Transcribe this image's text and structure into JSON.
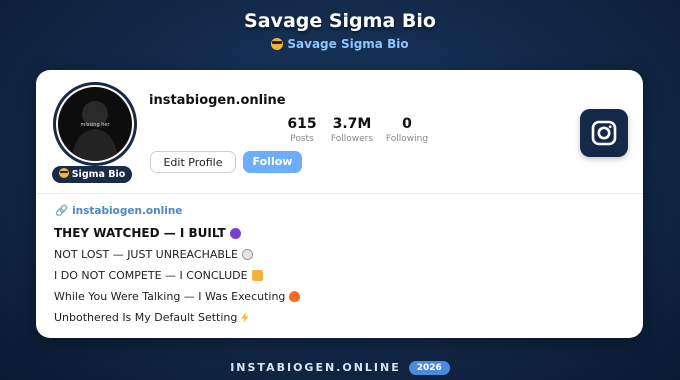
{
  "header": {
    "title": "Savage Sigma Bio",
    "subtitle": "Savage Sigma Bio",
    "subtitle_icon": "sunglasses-emoji-icon"
  },
  "profile": {
    "avatar_caption": "missing her",
    "badge_label": "Sigma Bio",
    "badge_icon": "sunglasses-emoji-icon",
    "username": "instabiogen.online",
    "stats": [
      {
        "value": "615",
        "label": "Posts"
      },
      {
        "value": "3.7M",
        "label": "Followers"
      },
      {
        "value": "0",
        "label": "Following"
      }
    ],
    "edit_button": "Edit Profile",
    "follow_button": "Follow",
    "instagram_icon": "instagram-icon"
  },
  "bio": {
    "link_icon": "link-icon",
    "link": "instabiogen.online",
    "lines": [
      {
        "text": "THEY WATCHED — I BUILT",
        "icon": "devil-emoji-icon"
      },
      {
        "text": "NOT LOST — JUST UNREACHABLE",
        "icon": "skull-emoji-icon"
      },
      {
        "text": "I DO NOT COMPETE — I CONCLUDE",
        "icon": "crown-emoji-icon"
      },
      {
        "text": "While You Were Talking — I Was Executing",
        "icon": "fire-emoji-icon"
      },
      {
        "text": "Unbothered Is My Default Setting",
        "icon": "lightning-emoji-icon"
      }
    ]
  },
  "footer": {
    "site": "INSTABIOGEN.ONLINE",
    "year": "2026"
  },
  "colors": {
    "background": "#142b4d",
    "accent": "#6aaefc",
    "link": "#4d86c4",
    "badge": "#1a2b47"
  }
}
